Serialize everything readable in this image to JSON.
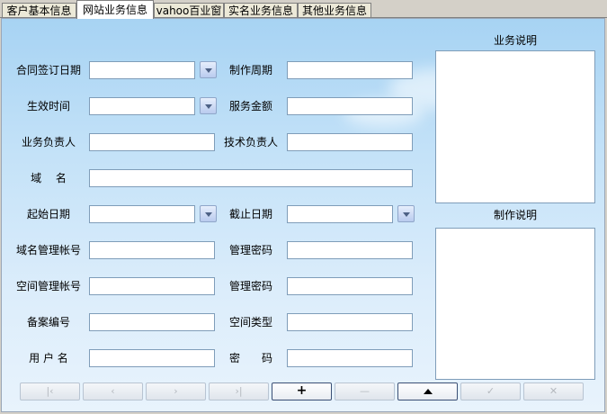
{
  "tabs": [
    {
      "label": "客户基本信息"
    },
    {
      "label": "网站业务信息"
    },
    {
      "label": "vahoo百业窗"
    },
    {
      "label": "实名业务信息"
    },
    {
      "label": "其他业务信息"
    }
  ],
  "active_tab": "网站业务信息",
  "form": {
    "contract_date_label": "合同签订日期",
    "production_period_label": "制作周期",
    "effective_date_label": "生效时间",
    "service_amount_label": "服务金额",
    "business_owner_label": "业务负责人",
    "tech_owner_label": "技术负责人",
    "domain_label": "域　 名",
    "start_date_label": "起始日期",
    "end_date_label": "截止日期",
    "domain_account_label": "域名管理帐号",
    "domain_password_label": "管理密码",
    "space_account_label": "空间管理帐号",
    "space_password_label": "管理密码",
    "record_number_label": "备案编号",
    "space_type_label": "空间类型",
    "username_label": "用 户 名",
    "password_label": "密　　码"
  },
  "side": {
    "business_desc_title": "业务说明",
    "production_desc_title": "制作说明"
  },
  "toolbar": {
    "first_symbol": "|‹",
    "prev_symbol": "‹",
    "next_symbol": "›",
    "last_symbol": "›|",
    "add_symbol": "+",
    "delete_symbol": "—",
    "save_symbol": "▲",
    "edit_symbol": "✓",
    "cancel_symbol": "✕"
  }
}
